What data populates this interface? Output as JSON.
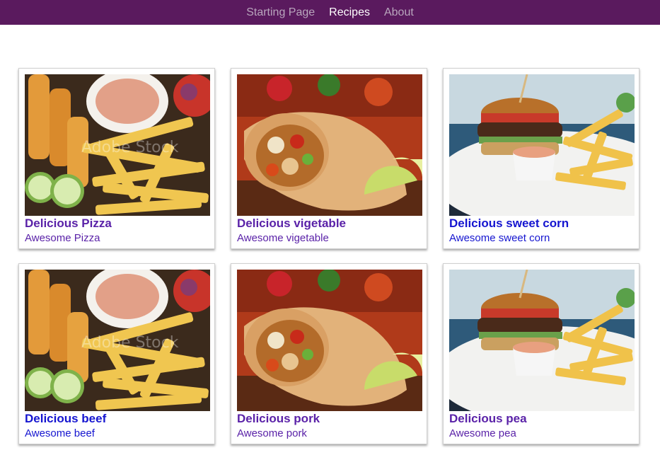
{
  "nav": {
    "items": [
      {
        "label": "Starting Page",
        "active": false
      },
      {
        "label": "Recipes",
        "active": true
      },
      {
        "label": "About",
        "active": false
      }
    ]
  },
  "cards": [
    {
      "title": "Delicious Pizza",
      "subtitle": "Awesome Pizza",
      "image": "fries-dip-photo",
      "color": "#5a22a8"
    },
    {
      "title": "Delicious vigetable",
      "subtitle": "Awesome vigetable",
      "image": "wrap-photo",
      "color": "#5a22a8"
    },
    {
      "title": "Delicious sweet corn",
      "subtitle": "Awesome sweet corn",
      "image": "burger-photo",
      "color": "#1515d0"
    },
    {
      "title": "Delicious beef",
      "subtitle": "Awesome beef",
      "image": "fries-dip-photo",
      "color": "#1515d0"
    },
    {
      "title": "Delicious pork",
      "subtitle": "Awesome pork",
      "image": "wrap-photo",
      "color": "#5a22a8"
    },
    {
      "title": "Delicious pea",
      "subtitle": "Awesome pea",
      "image": "burger-photo",
      "color": "#5a22a8"
    }
  ]
}
